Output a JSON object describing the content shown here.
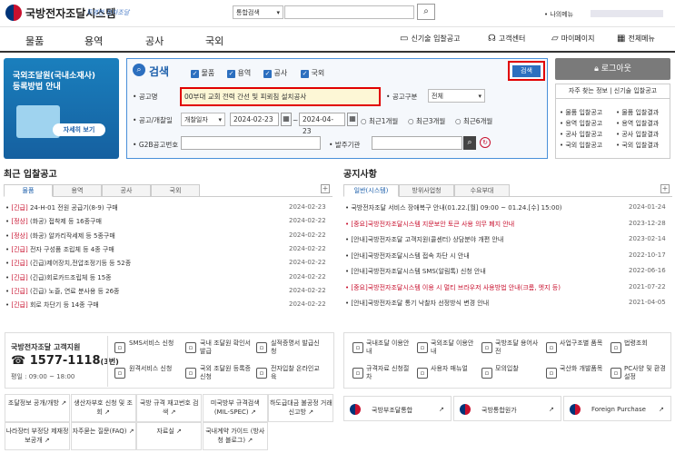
{
  "header": {
    "logo_title": "국방전자조달시스템",
    "logo_sub": "투명한 전자조달",
    "search_scope": "통합검색",
    "search_icon": "search-icon",
    "mymenu": "나의메뉴"
  },
  "nav": {
    "items": [
      "물품",
      "용역",
      "공사",
      "국외"
    ],
    "util": [
      "신기술 입찰공고",
      "고객센터",
      "마이페이지",
      "전체메뉴"
    ]
  },
  "banner": {
    "line1": "국외조달원(국내소재사)",
    "line2": "등록방법 안내",
    "btn": "자세히 보기"
  },
  "search": {
    "title": "검색",
    "checks": [
      "물품",
      "용역",
      "공사",
      "국외"
    ],
    "btn": "검색",
    "name_label": "공고명",
    "name_value": "00부대 교회 전력 간선 및 피뢰침 설치공사",
    "type_label": "공고구분",
    "type_value": "전체",
    "date_label": "공고/개찰일",
    "date_type": "개찰일자",
    "date_from": "2024-02-23",
    "date_sep": "~",
    "date_to": "2024-04-23",
    "radios": [
      "최근1개월",
      "최근3개월",
      "최근6개월"
    ],
    "g2b_label": "G2B공고번호",
    "org_label": "발주기관"
  },
  "side": {
    "logout": "로그아웃",
    "quick_head": "자주 찾는 정보 | 신기술 입찰공고",
    "links_left": [
      "물품 입찰공고",
      "용역 입찰공고",
      "공사 입찰공고",
      "국외 입찰공고"
    ],
    "links_right": [
      "물품 입찰결과",
      "용역 입찰결과",
      "공사 입찰결과",
      "국외 입찰결과"
    ]
  },
  "bids": {
    "title": "최근 입찰공고",
    "tabs": [
      "물품",
      "용역",
      "공사",
      "국외"
    ],
    "rows": [
      {
        "tag": "[긴급]",
        "text": "24-H-01 전원 공급기(8-9) 구매",
        "date": "2024-02-23"
      },
      {
        "tag": "[정상]",
        "text": "(화공) 접착제 등 16종구매",
        "date": "2024-02-22"
      },
      {
        "tag": "[정상]",
        "text": "(화공) 알카리작세제 등 5종구매",
        "date": "2024-02-22"
      },
      {
        "tag": "[긴급]",
        "text": "전자 구성품 조립체 등 4종 구매",
        "date": "2024-02-22"
      },
      {
        "tag": "[긴급]",
        "text": "(긴급)제어장치,전압조정기등 등 52종",
        "date": "2024-02-22"
      },
      {
        "tag": "[긴급]",
        "text": "(긴급)회로카드조립체 등 15종",
        "date": "2024-02-22"
      },
      {
        "tag": "[긴급]",
        "text": "(긴급) 노즐, 연료 분사용 등 26종",
        "date": "2024-02-22"
      },
      {
        "tag": "[긴급]",
        "text": "회로 차단기 등 14종 구매",
        "date": "2024-02-22"
      }
    ]
  },
  "notice": {
    "title": "공지사항",
    "tabs": [
      "일반(시스템)",
      "방위사업청",
      "수요부대"
    ],
    "rows": [
      {
        "text": "국방전자조달 서비스 장애복구 안내(01.22.[월] 09:00 ~ 01.24.[수] 15:00)",
        "date": "2024-01-24",
        "red": false
      },
      {
        "text": "[중요]국방전자조달시스템 지문보안 토큰 사용 의무 폐지 안내",
        "date": "2023-12-28",
        "red": true
      },
      {
        "text": "[안내]국방전자조달 고객지원(콜센터) 상담분야 개편 안내",
        "date": "2023-02-14",
        "red": false
      },
      {
        "text": "[안내]국방전자조달시스템 접속 차단 시 안내",
        "date": "2022-10-17",
        "red": false
      },
      {
        "text": "[안내]국방전자조달시스템 SMS(알림톡) 신청 안내",
        "date": "2022-06-16",
        "red": false
      },
      {
        "text": "[중요]국방전자조달시스템 이용 시 멀티 브라우저 사용방법 안내(크롬, 엣지 등)",
        "date": "2021-07-22",
        "red": true
      },
      {
        "text": "[안내]국방전자조달 통기 낙찰자 선정방식 변경 안내",
        "date": "2021-04-05",
        "red": false
      }
    ]
  },
  "cs": {
    "title": "국방전자조달 고객지원",
    "phone": "1577-1118",
    "phone_suffix": "(3번)",
    "hours": "평일 : 09:00 ~ 18:00",
    "svcs": [
      "SMS서비스 신청",
      "국내 조달원 확인서 발급",
      "실적증명서 발급신청",
      "원격서비스 신청",
      "국외 조달원 등록증 신청",
      "전자입찰 온라인교육"
    ]
  },
  "svc2": [
    "국내조달 이용안내",
    "국외조달 이용안내",
    "국방조달 용어사전",
    "사업구조별 품목",
    "법령조회",
    "규격자료 신청절차",
    "사용자 매뉴얼",
    "모의입찰",
    "국산화 개발품목",
    "PC사양 및 환경설정"
  ],
  "links": [
    "조달정보 공개/개방",
    "생산자부호 신청 및 조회",
    "국방 규격 재고번호 검색",
    "미국방부 규격검색 (MIL-SPEC)",
    "하도급대금 불공정 거래 신고방",
    "나라장터 부정당 제재정보공개",
    "자주묻는 질문(FAQ)",
    "자료실",
    "국내계약 가이드 (방사청 블로그)"
  ],
  "gov": [
    "국방부조달통합",
    "국방통합원가",
    "Foreign Purchase"
  ]
}
